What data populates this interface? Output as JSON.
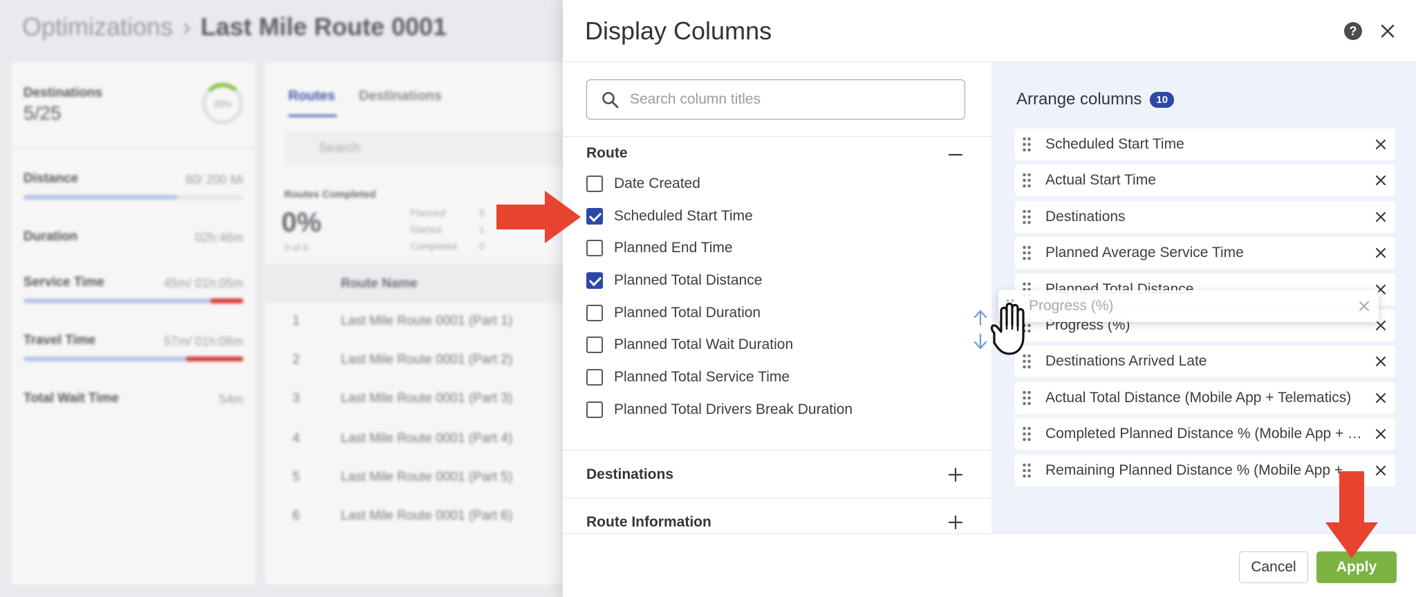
{
  "background": {
    "breadcrumb_parent": "Optimizations",
    "breadcrumb_separator": "›",
    "breadcrumb_current": "Last Mile Route 0001",
    "stats": {
      "destinations_label": "Destinations",
      "destinations_value": "5/25",
      "ring_percent": "20%",
      "distance_label": "Distance",
      "distance_value": "80/ 200 Mi",
      "duration_label": "Duration",
      "duration_value": "02h:46m",
      "service_label": "Service Time",
      "service_value": "45m/ 01h:05m",
      "travel_label": "Travel Time",
      "travel_value": "57m/ 01h:06m",
      "wait_label": "Total Wait Time",
      "wait_value": "54m"
    },
    "tabs": [
      "Routes",
      "Destinations"
    ],
    "search_placeholder": "Search",
    "routes_completed_label": "Routes Completed",
    "routes_completed_pct": "0%",
    "routes_completed_sub": "0 of 6",
    "legend": [
      {
        "label": "Planned",
        "value": "5"
      },
      {
        "label": "Started",
        "value": "1"
      },
      {
        "label": "Completed",
        "value": "0"
      }
    ],
    "table_header": "Route Name",
    "rows": [
      {
        "num": "1",
        "name": "Last Mile Route 0001 (Part 1)"
      },
      {
        "num": "2",
        "name": "Last Mile Route 0001 (Part 2)"
      },
      {
        "num": "3",
        "name": "Last Mile Route 0001 (Part 3)"
      },
      {
        "num": "4",
        "name": "Last Mile Route 0001 (Part 4)"
      },
      {
        "num": "5",
        "name": "Last Mile Route 0001 (Part 5)"
      },
      {
        "num": "6",
        "name": "Last Mile Route 0001 (Part 6)"
      }
    ]
  },
  "panel": {
    "title": "Display Columns",
    "help_icon": "?",
    "search_placeholder": "Search column titles",
    "sections": [
      {
        "title": "Route",
        "expanded": true
      },
      {
        "title": "Destinations",
        "expanded": false
      },
      {
        "title": "Route Information",
        "expanded": false
      }
    ],
    "route_options": [
      {
        "label": "Date Created",
        "checked": false
      },
      {
        "label": "Scheduled Start Time",
        "checked": true
      },
      {
        "label": "Planned End Time",
        "checked": false
      },
      {
        "label": "Planned Total Distance",
        "checked": true
      },
      {
        "label": "Planned Total Duration",
        "checked": false
      },
      {
        "label": "Planned Total Wait Duration",
        "checked": false
      },
      {
        "label": "Planned Total Service Time",
        "checked": false
      },
      {
        "label": "Planned Total Drivers Break Duration",
        "checked": false
      }
    ],
    "arrange_title": "Arrange columns",
    "arrange_count": "10",
    "arranged_columns": [
      "Scheduled Start Time",
      "Actual Start Time",
      "Destinations",
      "Planned Average Service Time",
      "Planned Total Distance",
      "Progress (%)",
      "Destinations Arrived Late",
      "Actual Total Distance (Mobile App + Telematics)",
      "Completed Planned Distance % (Mobile App + Telematics)",
      "Remaining Planned Distance % (Mobile App + Telematics)"
    ],
    "drag_ghost_label": "Progress (%)",
    "cancel_label": "Cancel",
    "apply_label": "Apply"
  },
  "colors": {
    "brand_blue": "#2d48a8",
    "apply_green": "#7cb342",
    "annotation_red": "#e8432f",
    "arrange_bg": "#eef2fa"
  }
}
